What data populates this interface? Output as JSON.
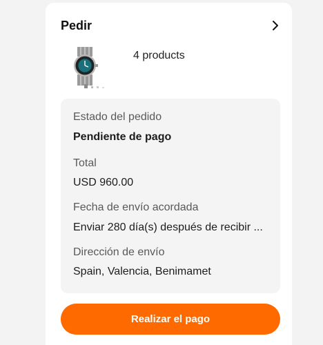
{
  "header": {
    "title": "Pedir",
    "chevron_icon": "chevron-right-icon"
  },
  "product": {
    "thumbnail_icon": "watch-thumbnail",
    "count_label": "4 products"
  },
  "order": {
    "status_label": "Estado del pedido",
    "status_value": "Pendiente de pago",
    "total_label": "Total",
    "total_value": "USD 960.00",
    "ship_date_label": "Fecha de envío acordada",
    "ship_date_value": "Enviar 280 día(s) después de recibir ...",
    "address_label": "Dirección de envío",
    "address_value": "Spain, Valencia, Benimamet"
  },
  "actions": {
    "pay_label": "Realizar el pago"
  },
  "colors": {
    "accent": "#ff6a00",
    "panel": "#f4f4f4"
  }
}
